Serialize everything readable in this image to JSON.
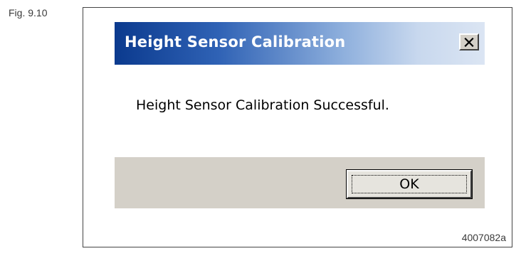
{
  "figure": {
    "label": "Fig. 9.10",
    "id": "4007082a"
  },
  "dialog": {
    "title": "Height Sensor Calibration",
    "close_label": "X",
    "message": "Height Sensor Calibration Successful.",
    "ok_label": "OK"
  },
  "icons": {
    "close": "close-icon"
  },
  "colors": {
    "title_start": "#0b3a8e",
    "title_end": "#dbe5f3",
    "face": "#d4d0c8",
    "content_bg": "#ffffff"
  }
}
